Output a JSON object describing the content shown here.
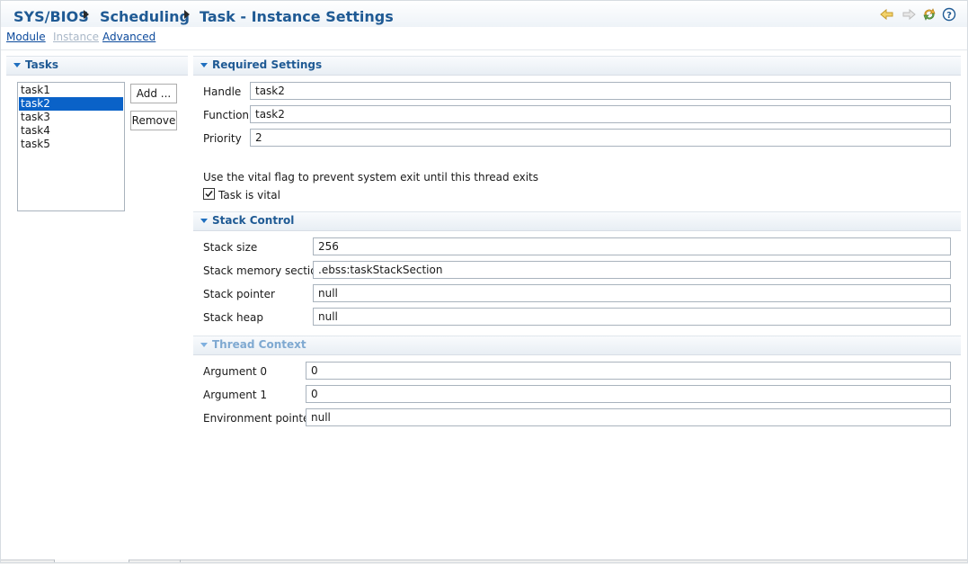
{
  "breadcrumb": {
    "items": [
      "SYS/BIOS",
      "Scheduling",
      "Task - Instance Settings"
    ]
  },
  "header_icons": [
    "back-arrow-icon",
    "forward-arrow-icon",
    "refresh-icon",
    "help-icon"
  ],
  "nav_links": {
    "module": "Module",
    "instance": "Instance",
    "advanced": "Advanced"
  },
  "tasks_panel": {
    "title": "Tasks",
    "items": [
      "task1",
      "task2",
      "task3",
      "task4",
      "task5"
    ],
    "selected": "task2",
    "add_button": "Add ...",
    "remove_button": "Remove"
  },
  "required_settings": {
    "title": "Required Settings",
    "handle_label": "Handle",
    "handle_value": "task2",
    "function_label": "Function",
    "function_value": "task2",
    "priority_label": "Priority",
    "priority_value": "2",
    "vital_note": "Use the vital flag to prevent system exit until this thread exits",
    "vital_checkbox_label": "Task is vital",
    "vital_checked": true
  },
  "stack_control": {
    "title": "Stack Control",
    "stack_size_label": "Stack size",
    "stack_size_value": "256",
    "stack_memory_label": "Stack memory section",
    "stack_memory_value": ".ebss:taskStackSection",
    "stack_pointer_label": "Stack pointer",
    "stack_pointer_value": "null",
    "stack_heap_label": "Stack heap",
    "stack_heap_value": "null"
  },
  "thread_context": {
    "title": "Thread Context",
    "arg0_label": "Argument 0",
    "arg0_value": "0",
    "arg1_label": "Argument 1",
    "arg1_value": "0",
    "env_label": "Environment pointer",
    "env_value": "null"
  },
  "colors": {
    "accent": "#1f5a94",
    "selection": "#0a62c8",
    "link": "#0c4a9c",
    "disabled_link": "#aab8c8"
  }
}
